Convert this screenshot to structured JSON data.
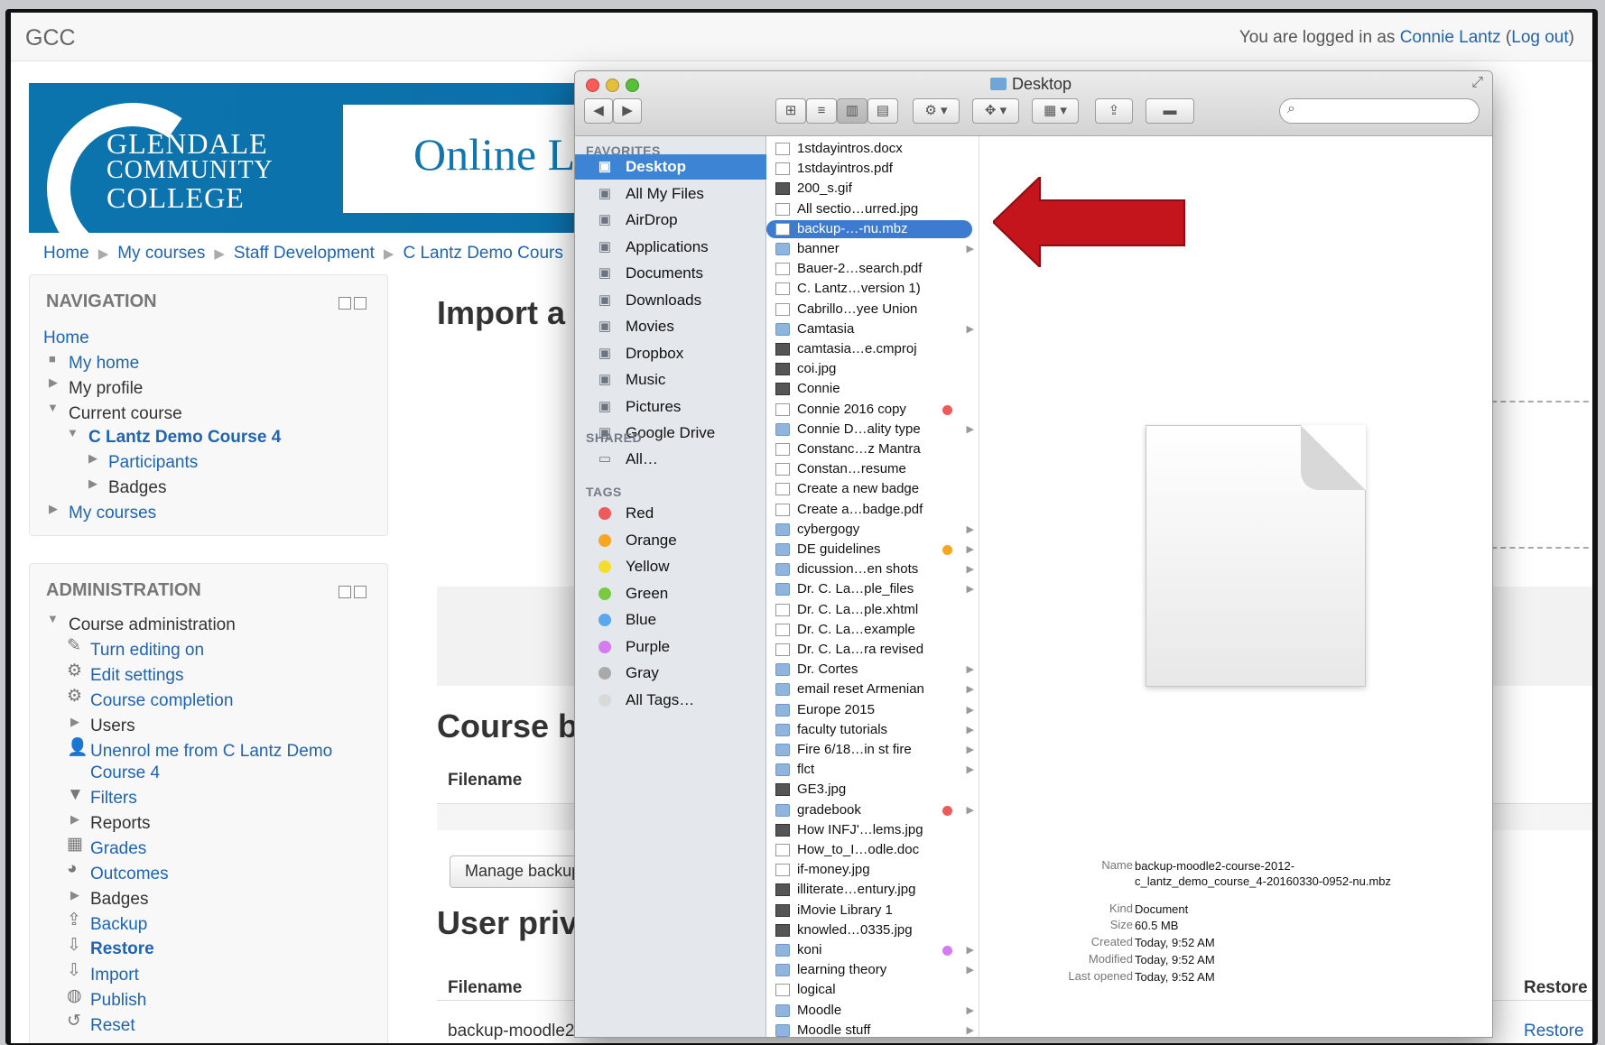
{
  "site": {
    "name": "GCC",
    "login_prefix": "You are logged in as",
    "user": "Connie Lantz",
    "logout": "Log out"
  },
  "banner": {
    "logo_line1": "GLENDALE",
    "logo_line2": "COMMUNITY",
    "logo_line3": "COLLEGE",
    "title": "Online L"
  },
  "breadcrumb": [
    "Home",
    "My courses",
    "Staff Development",
    "C Lantz Demo Cours"
  ],
  "navigation": {
    "title": "NAVIGATION",
    "home": "Home",
    "my_home": "My home",
    "my_profile": "My profile",
    "current_course": "Current course",
    "course": "C Lantz Demo Course 4",
    "participants": "Participants",
    "badges": "Badges",
    "my_courses": "My courses"
  },
  "administration": {
    "title": "ADMINISTRATION",
    "course_admin": "Course administration",
    "turn_editing": "Turn editing on",
    "edit_settings": "Edit settings",
    "course_completion": "Course completion",
    "users": "Users",
    "unenrol1": "Unenrol me from C Lantz Demo",
    "unenrol2": "Course 4",
    "filters": "Filters",
    "reports": "Reports",
    "grades": "Grades",
    "outcomes": "Outcomes",
    "badges": "Badges",
    "backup": "Backup",
    "restore": "Restore",
    "import": "Import",
    "publish": "Publish",
    "reset": "Reset"
  },
  "main": {
    "heading": "Import a",
    "course_heading": "Course b",
    "user_heading": "User priv",
    "filename1": "Filename",
    "manage_btn": "Manage backup",
    "filename2": "Filename",
    "restore_head": "Restore",
    "restore_link": "Restore",
    "file_value": "backup-moodle2-"
  },
  "finder": {
    "title": "Desktop",
    "favorites_label": "FAVORITES",
    "favorites": [
      {
        "label": "Desktop",
        "icon": "desktop-icon"
      },
      {
        "label": "All My Files",
        "icon": "all-files-icon"
      },
      {
        "label": "AirDrop",
        "icon": "airdrop-icon"
      },
      {
        "label": "Applications",
        "icon": "applications-icon"
      },
      {
        "label": "Documents",
        "icon": "documents-icon"
      },
      {
        "label": "Downloads",
        "icon": "downloads-icon"
      },
      {
        "label": "Movies",
        "icon": "movies-icon"
      },
      {
        "label": "Dropbox",
        "icon": "dropbox-icon"
      },
      {
        "label": "Music",
        "icon": "music-icon"
      },
      {
        "label": "Pictures",
        "icon": "pictures-icon"
      },
      {
        "label": "Google Drive",
        "icon": "folder-icon"
      }
    ],
    "shared_label": "SHARED",
    "shared_all": "All…",
    "tags_label": "TAGS",
    "tags": [
      {
        "label": "Red",
        "color": "#f0595a"
      },
      {
        "label": "Orange",
        "color": "#f6a623"
      },
      {
        "label": "Yellow",
        "color": "#f3dd2d"
      },
      {
        "label": "Green",
        "color": "#7ac943"
      },
      {
        "label": "Blue",
        "color": "#5aa7ef"
      },
      {
        "label": "Purple",
        "color": "#d57bef"
      },
      {
        "label": "Gray",
        "color": "#a9a9a9"
      },
      {
        "label": "All Tags…",
        "color": "#d9d9d9"
      }
    ],
    "files": [
      {
        "name": "1stdayintros.docx",
        "kind": "doc"
      },
      {
        "name": "1stdayintros.pdf",
        "kind": "doc"
      },
      {
        "name": "200_s.gif",
        "kind": "img"
      },
      {
        "name": "All sectio…urred.jpg",
        "kind": "doc"
      },
      {
        "name": "backup-…-nu.mbz",
        "kind": "doc",
        "selected": true
      },
      {
        "name": "banner",
        "kind": "folder",
        "arrow": true
      },
      {
        "name": "Bauer-2…search.pdf",
        "kind": "doc"
      },
      {
        "name": "C. Lantz…version 1)",
        "kind": "doc"
      },
      {
        "name": "Cabrillo…yee Union",
        "kind": "doc"
      },
      {
        "name": "Camtasia",
        "kind": "folder",
        "arrow": true
      },
      {
        "name": "camtasia…e.cmproj",
        "kind": "img"
      },
      {
        "name": "coi.jpg",
        "kind": "img"
      },
      {
        "name": "Connie",
        "kind": "img"
      },
      {
        "name": "Connie 2016 copy",
        "kind": "doc",
        "tag": "#f0595a"
      },
      {
        "name": "Connie D…ality type",
        "kind": "folder",
        "arrow": true
      },
      {
        "name": "Constanc…z Mantra",
        "kind": "doc"
      },
      {
        "name": "Constan…resume",
        "kind": "doc"
      },
      {
        "name": "Create a new badge",
        "kind": "doc"
      },
      {
        "name": "Create a…badge.pdf",
        "kind": "doc"
      },
      {
        "name": "cybergogy",
        "kind": "folder",
        "arrow": true
      },
      {
        "name": "DE guidelines",
        "kind": "folder",
        "arrow": true,
        "tag": "#f6a623"
      },
      {
        "name": "dicussion…en shots",
        "kind": "folder",
        "arrow": true
      },
      {
        "name": "Dr. C. La…ple_files",
        "kind": "folder",
        "arrow": true
      },
      {
        "name": "Dr. C. La…ple.xhtml",
        "kind": "doc"
      },
      {
        "name": "Dr. C. La…example",
        "kind": "doc"
      },
      {
        "name": "Dr. C. La…ra revised",
        "kind": "doc"
      },
      {
        "name": "Dr. Cortes",
        "kind": "folder",
        "arrow": true
      },
      {
        "name": "email reset Armenian",
        "kind": "folder",
        "arrow": true
      },
      {
        "name": "Europe 2015",
        "kind": "folder",
        "arrow": true
      },
      {
        "name": "faculty tutorials",
        "kind": "folder",
        "arrow": true
      },
      {
        "name": "Fire 6/18…in st fire",
        "kind": "folder",
        "arrow": true
      },
      {
        "name": "flct",
        "kind": "folder",
        "arrow": true
      },
      {
        "name": "GE3.jpg",
        "kind": "img"
      },
      {
        "name": "gradebook",
        "kind": "folder",
        "arrow": true,
        "tag": "#f0595a"
      },
      {
        "name": "How INFJ'…lems.jpg",
        "kind": "img"
      },
      {
        "name": "How_to_I…odle.doc",
        "kind": "doc"
      },
      {
        "name": "if-money.jpg",
        "kind": "doc"
      },
      {
        "name": "illiterate…entury.jpg",
        "kind": "img"
      },
      {
        "name": "iMovie Library 1",
        "kind": "img"
      },
      {
        "name": "knowled…0335.jpg",
        "kind": "img"
      },
      {
        "name": "koni",
        "kind": "folder",
        "arrow": true,
        "tag": "#d57bef"
      },
      {
        "name": "learning theory",
        "kind": "folder",
        "arrow": true
      },
      {
        "name": "logical",
        "kind": "doc"
      },
      {
        "name": "Moodle",
        "kind": "folder",
        "arrow": true
      },
      {
        "name": "Moodle stuff",
        "kind": "folder",
        "arrow": true
      }
    ],
    "info": {
      "name_key": "Name",
      "name_val": "backup-moodle2-course-2012-c_lantz_demo_course_4-20160330-0952-nu.mbz",
      "kind_key": "Kind",
      "kind_val": "Document",
      "size_key": "Size",
      "size_val": "60.5 MB",
      "created_key": "Created",
      "created_val": "Today, 9:52 AM",
      "modified_key": "Modified",
      "modified_val": "Today, 9:52 AM",
      "opened_key": "Last opened",
      "opened_val": "Today, 9:52 AM"
    }
  },
  "colors": {
    "link": "#1f64b3",
    "banner": "#0c74ad",
    "selection": "#3d84d4",
    "arrow": "#c4151c"
  }
}
